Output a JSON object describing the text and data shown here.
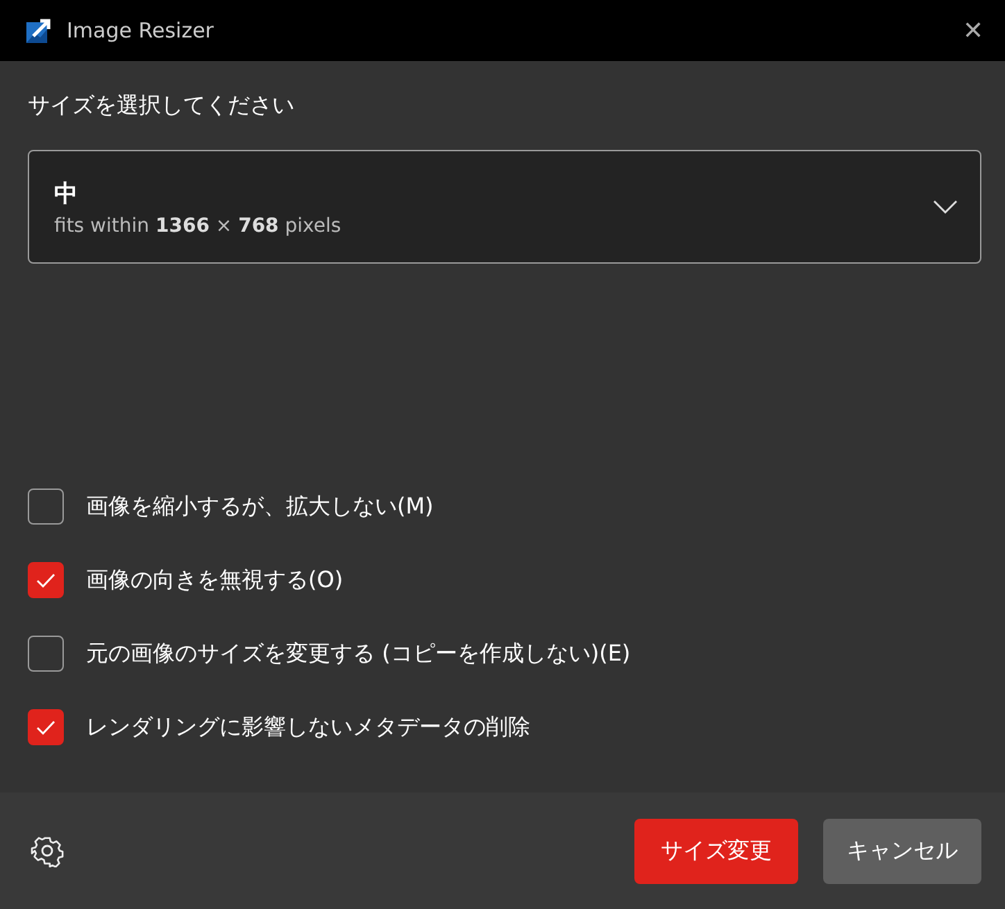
{
  "window": {
    "title": "Image Resizer",
    "close": "✕"
  },
  "size_select": {
    "label": "サイズを選択してください",
    "name": "中",
    "description": "fits within **1366** × **768** pixels"
  },
  "options": [
    {
      "label": "画像を縮小するが、拡大しない(M)",
      "checked": false
    },
    {
      "label": "画像の向きを無視する(O)",
      "checked": true
    },
    {
      "label": "元の画像のサイズを変更する (コピーを作成しない)(E)",
      "checked": false
    },
    {
      "label": "レンダリングに影響しないメタデータの削除",
      "checked": true
    }
  ],
  "buttons": [
    {
      "label": "サイズ変更",
      "kind": "primary"
    },
    {
      "label": "キャンセル",
      "kind": "secondary"
    }
  ]
}
